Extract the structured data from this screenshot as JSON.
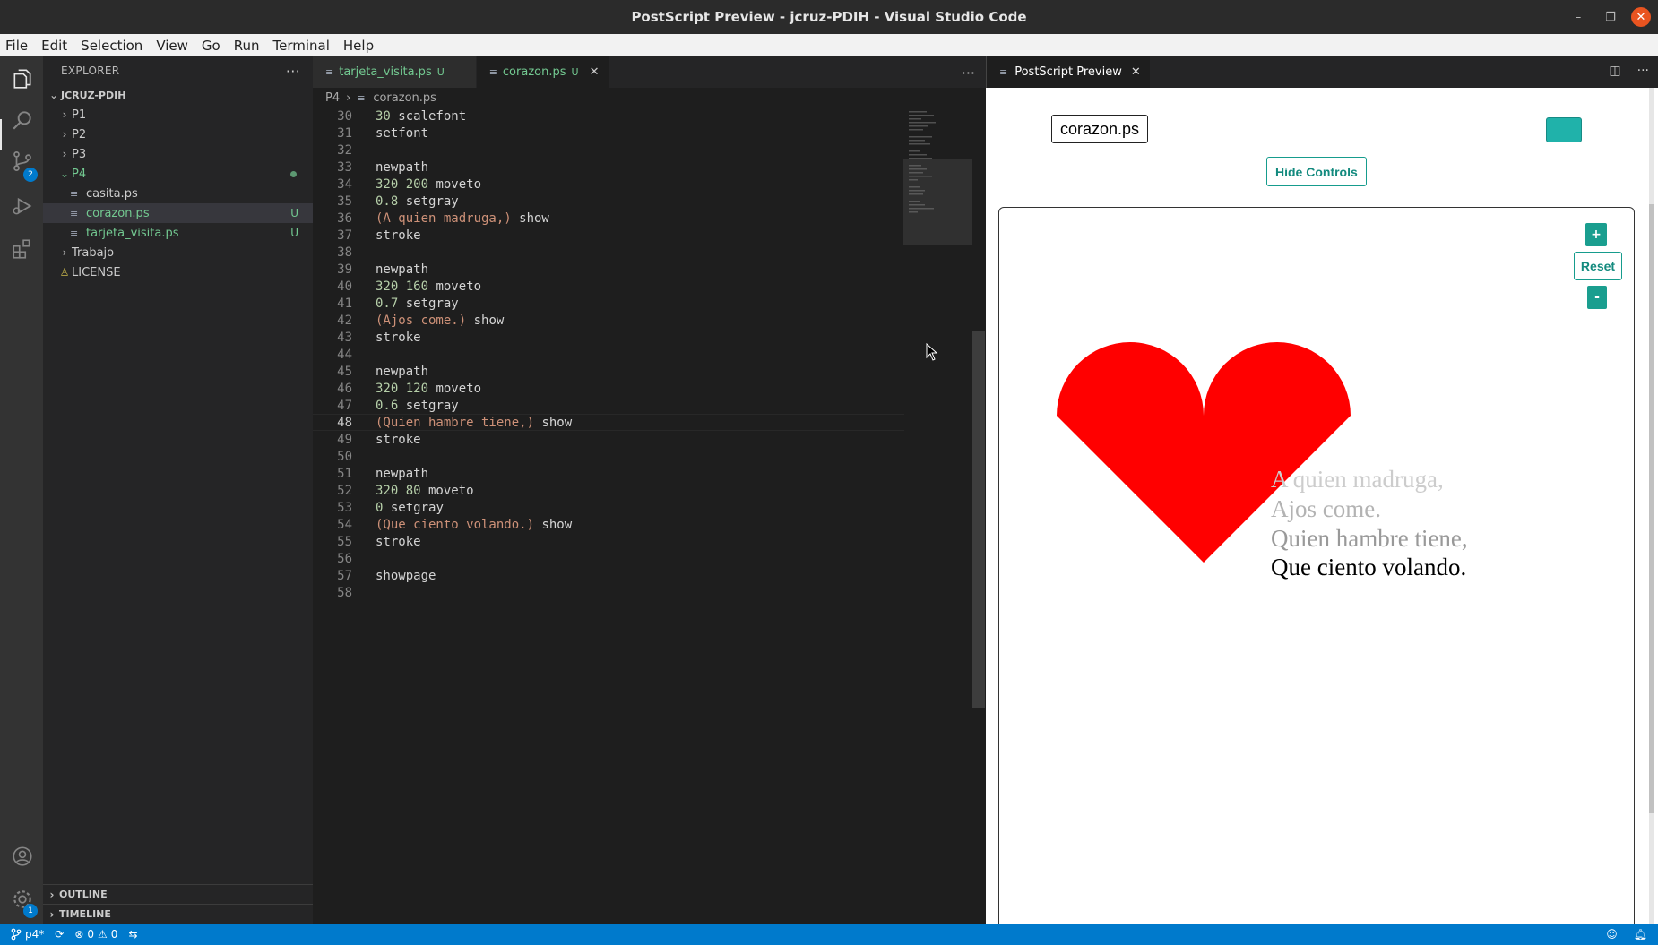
{
  "window": {
    "title": "PostScript Preview - jcruz-PDIH - Visual Studio Code"
  },
  "menu": [
    "File",
    "Edit",
    "Selection",
    "View",
    "Go",
    "Run",
    "Terminal",
    "Help"
  ],
  "activity": {
    "scm_badge": "2",
    "settings_badge": "1"
  },
  "sidebar": {
    "header": "EXPLORER",
    "root": "JCRUZ-PDIH",
    "tree": [
      {
        "label": "P1",
        "type": "folder"
      },
      {
        "label": "P2",
        "type": "folder"
      },
      {
        "label": "P3",
        "type": "folder"
      },
      {
        "label": "P4",
        "type": "folder-open"
      },
      {
        "label": "casita.ps",
        "type": "file"
      },
      {
        "label": "corazon.ps",
        "type": "file",
        "status": "U"
      },
      {
        "label": "tarjeta_visita.ps",
        "type": "file",
        "status": "U"
      },
      {
        "label": "Trabajo",
        "type": "folder"
      },
      {
        "label": "LICENSE",
        "type": "license"
      }
    ],
    "outline": "OUTLINE",
    "timeline": "TIMELINE"
  },
  "editor": {
    "tabs": [
      {
        "label": "tarjeta_visita.ps",
        "status": "U"
      },
      {
        "label": "corazon.ps",
        "status": "U"
      }
    ],
    "breadcrumb": [
      "P4",
      "corazon.ps"
    ],
    "lines": [
      {
        "n": "30",
        "parts": [
          [
            "n",
            "30"
          ],
          [
            "p",
            " scalefont"
          ]
        ]
      },
      {
        "n": "31",
        "parts": [
          [
            "p",
            "setfont"
          ]
        ]
      },
      {
        "n": "32",
        "parts": []
      },
      {
        "n": "33",
        "parts": [
          [
            "p",
            "newpath"
          ]
        ]
      },
      {
        "n": "34",
        "parts": [
          [
            "n",
            "320 200"
          ],
          [
            "p",
            " moveto"
          ]
        ]
      },
      {
        "n": "35",
        "parts": [
          [
            "n",
            "0.8"
          ],
          [
            "p",
            " setgray"
          ]
        ]
      },
      {
        "n": "36",
        "parts": [
          [
            "s",
            "(A quien madruga,)"
          ],
          [
            "p",
            " show"
          ]
        ]
      },
      {
        "n": "37",
        "parts": [
          [
            "p",
            "stroke"
          ]
        ]
      },
      {
        "n": "38",
        "parts": []
      },
      {
        "n": "39",
        "parts": [
          [
            "p",
            "newpath"
          ]
        ]
      },
      {
        "n": "40",
        "parts": [
          [
            "n",
            "320 160"
          ],
          [
            "p",
            " moveto"
          ]
        ]
      },
      {
        "n": "41",
        "parts": [
          [
            "n",
            "0.7"
          ],
          [
            "p",
            " setgray"
          ]
        ]
      },
      {
        "n": "42",
        "parts": [
          [
            "s",
            "(Ajos come.)"
          ],
          [
            "p",
            " show"
          ]
        ]
      },
      {
        "n": "43",
        "parts": [
          [
            "p",
            "stroke"
          ]
        ]
      },
      {
        "n": "44",
        "parts": []
      },
      {
        "n": "45",
        "parts": [
          [
            "p",
            "newpath"
          ]
        ]
      },
      {
        "n": "46",
        "parts": [
          [
            "n",
            "320 120"
          ],
          [
            "p",
            " moveto"
          ]
        ]
      },
      {
        "n": "47",
        "parts": [
          [
            "n",
            "0.6"
          ],
          [
            "p",
            " setgray"
          ]
        ]
      },
      {
        "n": "48",
        "parts": [
          [
            "s",
            "(Quien hambre tiene,)"
          ],
          [
            "p",
            " show"
          ]
        ],
        "current": true
      },
      {
        "n": "49",
        "parts": [
          [
            "p",
            "stroke"
          ]
        ]
      },
      {
        "n": "50",
        "parts": []
      },
      {
        "n": "51",
        "parts": [
          [
            "p",
            "newpath"
          ]
        ]
      },
      {
        "n": "52",
        "parts": [
          [
            "n",
            "320 80"
          ],
          [
            "p",
            " moveto"
          ]
        ]
      },
      {
        "n": "53",
        "parts": [
          [
            "n",
            "0"
          ],
          [
            "p",
            " setgray"
          ]
        ]
      },
      {
        "n": "54",
        "parts": [
          [
            "s",
            "(Que ciento volando.)"
          ],
          [
            "p",
            " show"
          ]
        ]
      },
      {
        "n": "55",
        "parts": [
          [
            "p",
            "stroke"
          ]
        ]
      },
      {
        "n": "56",
        "parts": []
      },
      {
        "n": "57",
        "parts": [
          [
            "p",
            "showpage"
          ]
        ]
      },
      {
        "n": "58",
        "parts": []
      }
    ]
  },
  "preview": {
    "tab_label": "PostScript Preview",
    "file_label": "corazon.ps",
    "hide_controls": "Hide Controls",
    "zoom_in": "+",
    "zoom_reset": "Reset",
    "zoom_out": "-",
    "accent_color": "#20b2aa",
    "heart_color": "#ff0000",
    "poem": [
      {
        "text": "A quien madruga,",
        "gray": 0.8
      },
      {
        "text": "Ajos come.",
        "gray": 0.7
      },
      {
        "text": "Quien hambre tiene,",
        "gray": 0.6
      },
      {
        "text": "Que ciento volando.",
        "gray": 0
      }
    ]
  },
  "status": {
    "branch": "p4*",
    "errors": "0",
    "warnings": "0"
  }
}
